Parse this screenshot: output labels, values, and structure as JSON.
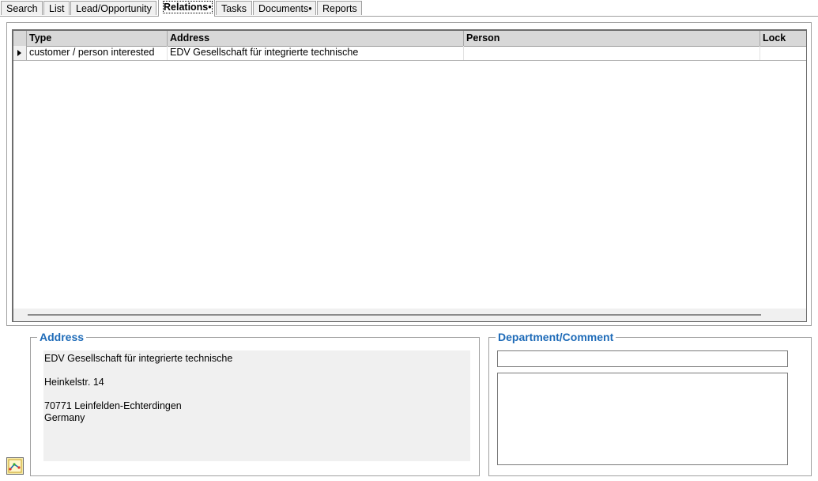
{
  "tabs": [
    {
      "label": "Search"
    },
    {
      "label": "List"
    },
    {
      "label": "Lead/Opportunity"
    },
    {
      "label": "Relations•",
      "active": true
    },
    {
      "label": "Tasks"
    },
    {
      "label": "Documents•"
    },
    {
      "label": "Reports"
    }
  ],
  "grid": {
    "columns": [
      "Type",
      "Address",
      "Person",
      "Lock"
    ],
    "rows": [
      {
        "type": "customer / person interested",
        "address": "EDV Gesellschaft für integrierte technische",
        "person": "",
        "lock": ""
      }
    ]
  },
  "address_group": {
    "title": "Address",
    "text": "EDV Gesellschaft für integrierte technische\n\nHeinkelstr. 14\n\n70771 Leinfelden-Echterdingen\nGermany"
  },
  "department_group": {
    "title": "Department/Comment",
    "department_value": "",
    "comment_value": ""
  },
  "icons": {
    "relation_button": "relation-diagram-icon",
    "row_indicator": "row-pointer-icon"
  },
  "colors": {
    "group_title": "#1e6bb8"
  }
}
